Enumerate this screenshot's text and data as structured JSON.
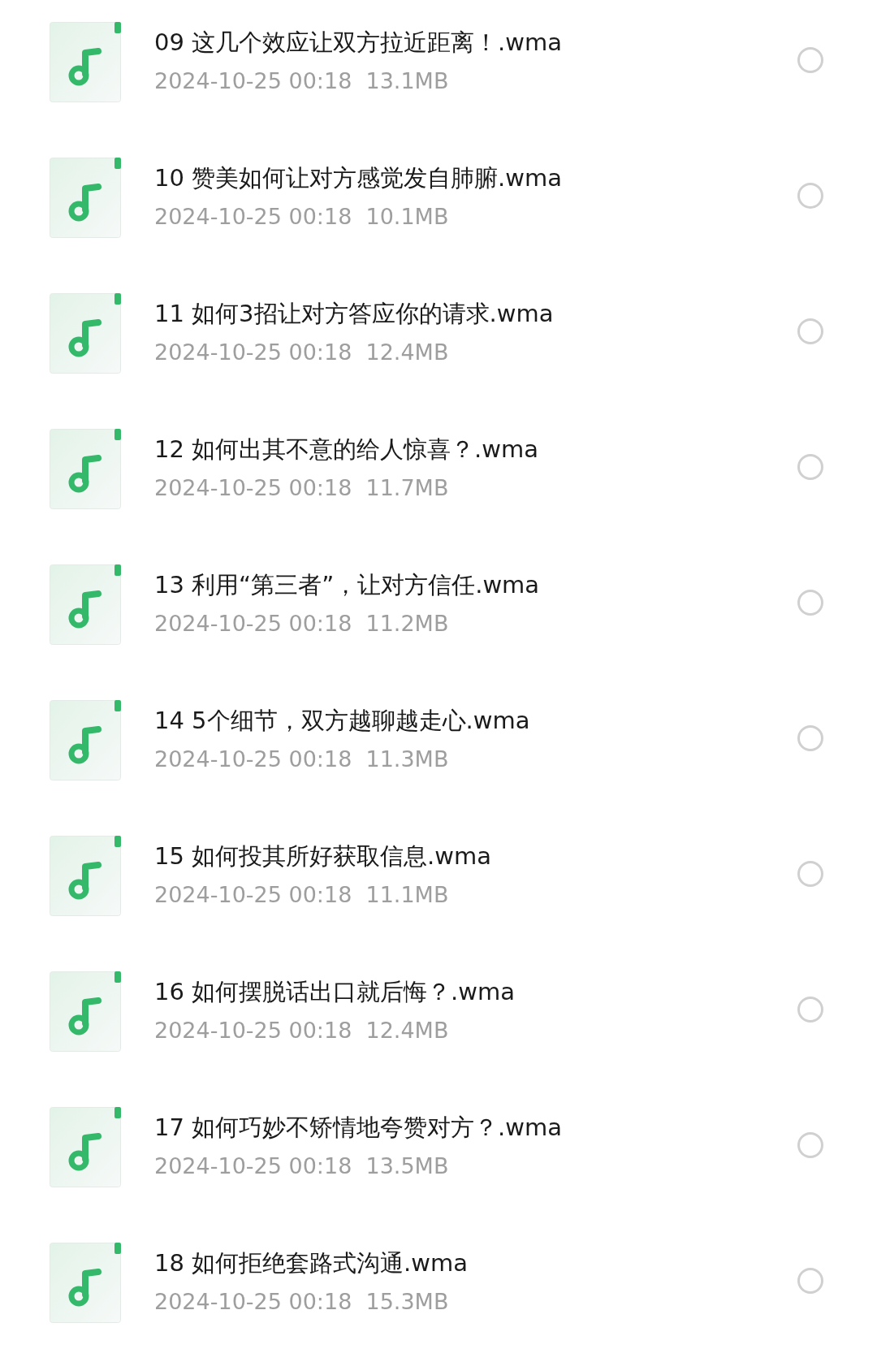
{
  "files": [
    {
      "name": "09 这几个效应让双方拉近距离！.wma",
      "date": "2024-10-25 00:18",
      "size": "13.1MB",
      "selected": false
    },
    {
      "name": "10 赞美如何让对方感觉发自肺腑.wma",
      "date": "2024-10-25 00:18",
      "size": "10.1MB",
      "selected": false
    },
    {
      "name": "11 如何3招让对方答应你的请求.wma",
      "date": "2024-10-25 00:18",
      "size": "12.4MB",
      "selected": false
    },
    {
      "name": "12 如何出其不意的给人惊喜？.wma",
      "date": "2024-10-25 00:18",
      "size": "11.7MB",
      "selected": false
    },
    {
      "name": "13 利用“第三者”，让对方信任.wma",
      "date": "2024-10-25 00:18",
      "size": "11.2MB",
      "selected": false
    },
    {
      "name": "14 5个细节，双方越聊越走心.wma",
      "date": "2024-10-25 00:18",
      "size": "11.3MB",
      "selected": false
    },
    {
      "name": "15 如何投其所好获取信息.wma",
      "date": "2024-10-25 00:18",
      "size": "11.1MB",
      "selected": false
    },
    {
      "name": "16 如何摆脱话出口就后悔？.wma",
      "date": "2024-10-25 00:18",
      "size": "12.4MB",
      "selected": false
    },
    {
      "name": "17 如何巧妙不矫情地夸赞对方？.wma",
      "date": "2024-10-25 00:18",
      "size": "13.5MB",
      "selected": false
    },
    {
      "name": "18 如何拒绝套路式沟通.wma",
      "date": "2024-10-25 00:18",
      "size": "15.3MB",
      "selected": false
    }
  ]
}
